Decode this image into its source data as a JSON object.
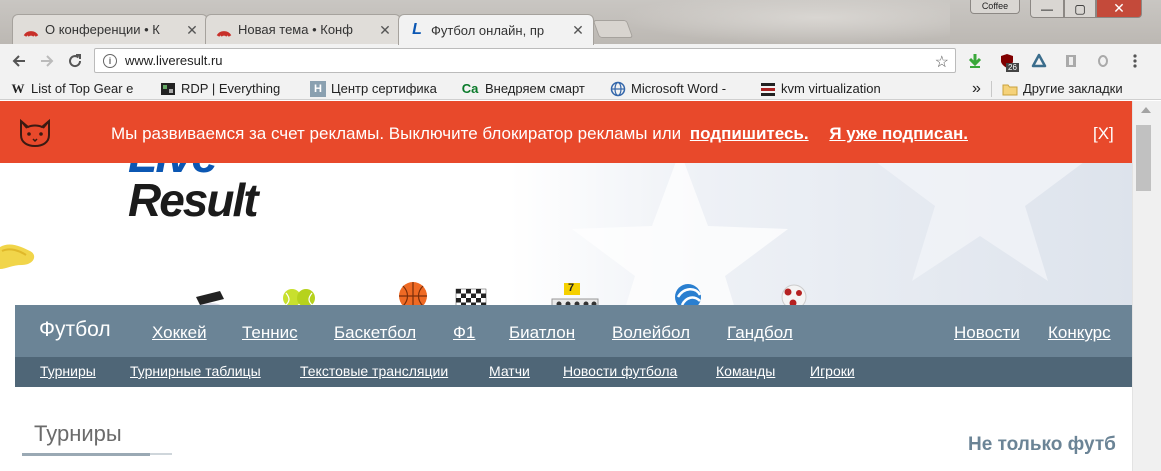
{
  "browser": {
    "tabs": [
      {
        "title": "О конференции • К",
        "active": false
      },
      {
        "title": "Новая тема • Конф",
        "active": false
      },
      {
        "title": "Футбол онлайн, пр",
        "active": true
      }
    ],
    "tab_close": "✕",
    "coffee_label": "Coffee",
    "window": {
      "minimize": "—",
      "maximize": "▢",
      "close": "✕"
    },
    "url": "www.liveresult.ru",
    "info_glyph": "i",
    "star_glyph": "☆",
    "ext_badge": "26",
    "bookmarks": [
      {
        "label": "List of Top Gear e",
        "icon": "W"
      },
      {
        "label": "RDP | Everything",
        "icon": "rdp"
      },
      {
        "label": "Центр сертифика",
        "icon": "H"
      },
      {
        "label": "Внедряем смарт",
        "icon": "Ca"
      },
      {
        "label": "Microsoft Word -",
        "icon": "globe"
      },
      {
        "label": "kvm virtualization",
        "icon": "kvm"
      }
    ],
    "bookmarks_overflow": "»",
    "other_bookmarks": "Другие закладки"
  },
  "ad_banner": {
    "message": "Мы развиваемся за счет рекламы. Выключите блокиратор рекламы или",
    "subscribe_link": "подпишитесь.",
    "subscribed_link": "Я уже подписан.",
    "close": "[X]",
    "color": "#e8492b"
  },
  "logo": {
    "line1": "Live",
    "line2": "Result"
  },
  "nav": {
    "items": [
      "Футбол",
      "Хоккей",
      "Теннис",
      "Баскетбол",
      "Ф1",
      "Биатлон",
      "Волейбол",
      "Гандбол"
    ],
    "right_items": [
      "Новости",
      "Конкурс"
    ],
    "color": "#6b8496"
  },
  "subnav": {
    "items": [
      "Турниры",
      "Турнирные таблицы",
      "Текстовые трансляции",
      "Матчи",
      "Новости футбола",
      "Команды",
      "Игроки"
    ],
    "color": "#4f6677"
  },
  "biathlon_badge": "7",
  "main": {
    "section_title": "Турниры",
    "right_title": "Не только футб"
  }
}
